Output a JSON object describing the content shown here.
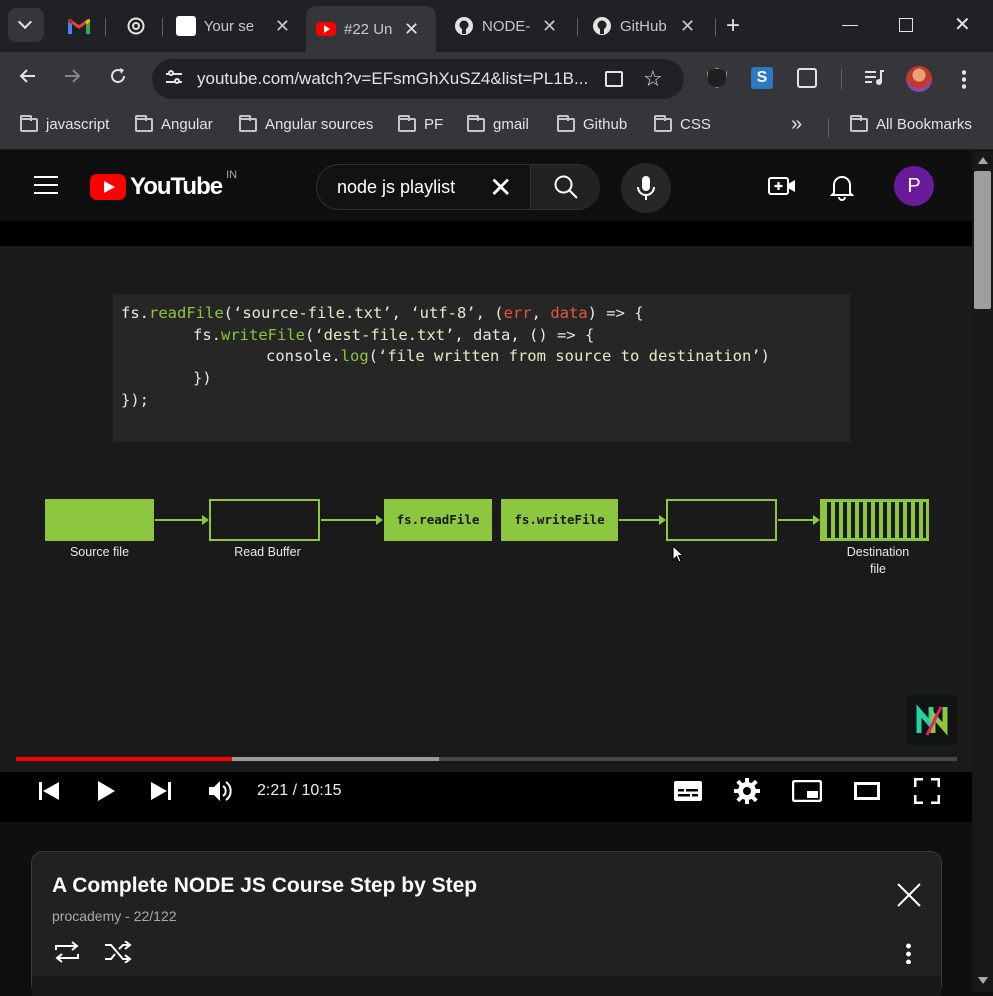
{
  "browser": {
    "tabs": [
      {
        "label": "",
        "icon": "gmail-icon"
      },
      {
        "label": "",
        "icon": "chatgpt-icon"
      },
      {
        "label": "Your se",
        "icon": "site-icon"
      },
      {
        "label": "#22 Un",
        "icon": "youtube-icon",
        "active": true
      },
      {
        "label": "NODE-",
        "icon": "github-icon"
      },
      {
        "label": "GitHub",
        "icon": "github-icon"
      }
    ],
    "url": "youtube.com/watch?v=EFsmGhXuSZ4&list=PL1B...",
    "bookmarks": [
      "javascript",
      "Angular",
      "Angular sources",
      "PF",
      "gmail",
      "Github",
      "CSS"
    ],
    "all_bookmarks": "All Bookmarks"
  },
  "youtube": {
    "logo_text": "YouTube",
    "region": "IN",
    "search_value": "node js playlist",
    "avatar_letter": "P"
  },
  "video": {
    "code_lines": [
      "fs.readFile('source-file.txt', 'utf-8', (err, data) => {",
      "fs.writeFile('dest-file.txt', data, () => {",
      "console.log('file written from source to destination')",
      "})",
      "});"
    ],
    "diagram": {
      "source_label": "Source file",
      "read_buffer_label": "Read Buffer",
      "readfile_label": "fs.readFile",
      "writefile_label": "fs.writeFile",
      "destination_label_1": "Destination",
      "destination_label_2": "file"
    },
    "time": "2:21 / 10:15",
    "progress_played": 0.23,
    "progress_buffered": 0.45
  },
  "playlist": {
    "title": "A Complete NODE JS Course Step by Step",
    "meta": "procademy - 22/122"
  },
  "colors": {
    "accent_green": "#8dc63f",
    "progress_red": "#ff0000",
    "avatar_purple": "#6a1b9a"
  }
}
